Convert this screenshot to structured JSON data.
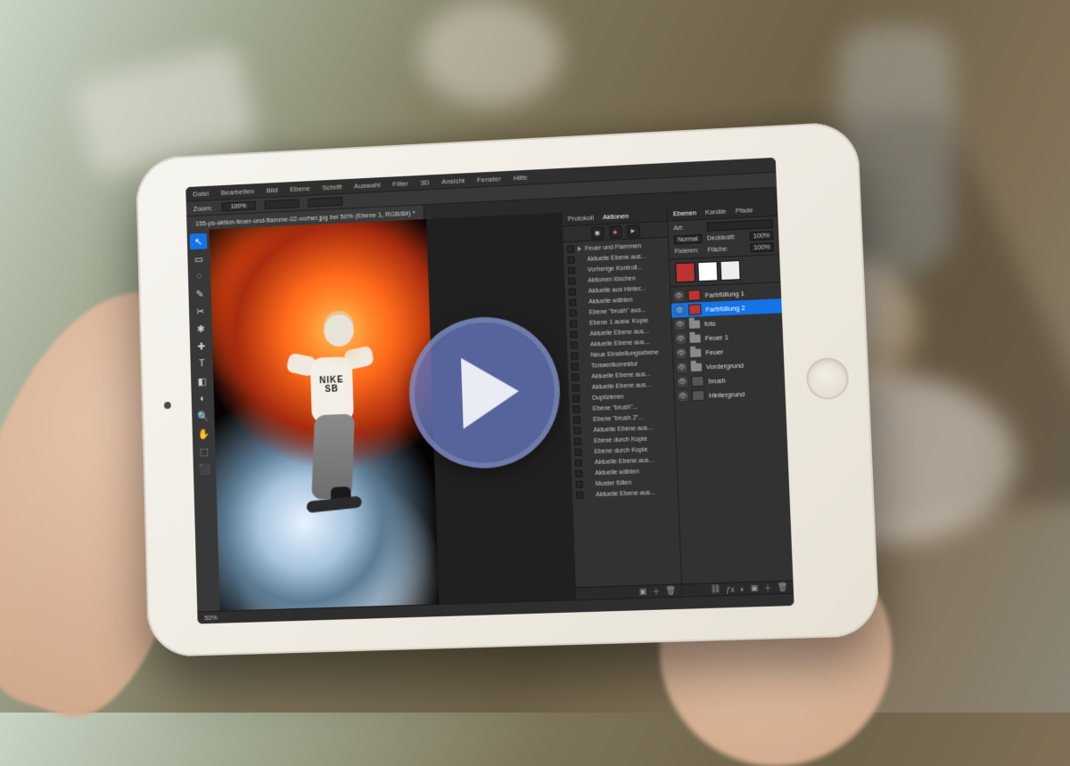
{
  "play_button_color": "#6071b2",
  "app": {
    "menubar": {
      "items": [
        "Datei",
        "Bearbeiten",
        "Bild",
        "Ebene",
        "Schrift",
        "Auswahl",
        "Filter",
        "3D",
        "Ansicht",
        "Fenster",
        "Hilfe"
      ]
    },
    "options_bar": {
      "zoom_label": "Zoom:",
      "zoom_value": "100%"
    },
    "document_tab": "155-ps-aktion-feuer-und-flamme-02-vorher.jpg bei 50% (Ebene 1, RGB/8#) *",
    "canvas": {
      "hoodie_text": "NIKE SB"
    },
    "status_bar": {
      "zoom": "50%"
    },
    "panels": {
      "actions": {
        "tabs": {
          "protocol": "Protokoll",
          "actions": "Aktionen"
        },
        "set_name": "Feuer und Flammen",
        "items": [
          "Aktuelle Ebene aus...",
          "Vorherige Kontroll...",
          "Aktionen löschen",
          "Aktuelle aus Hinter...",
          "Aktuelle wählen",
          "Ebene \"brush\" aus...",
          "Ebene 1 ausw. Kopie",
          "Aktuelle Ebene aus...",
          "Aktuelle Ebene aus...",
          "Neue Einstellungsebene",
          "Tonwertkorrektur",
          "Aktuelle Ebene aus...",
          "Aktuelle Ebene aus...",
          "Duplizieren",
          "Ebene \"brush\"...",
          "Ebene \"brush 2\"...",
          "Aktuelle Ebene aus...",
          "Ebene durch Kopie",
          "Ebene durch Kopie",
          "Aktuelle Ebene aus...",
          "Aktuelle wählen",
          "Muster füllen",
          "Aktuelle Ebene aus..."
        ]
      },
      "layers": {
        "tabs": {
          "layers": "Ebenen",
          "channels": "Kanäle",
          "paths": "Pfade"
        },
        "filter_label": "Art:",
        "blend_label": "Normal",
        "opacity_label": "Deckkraft:",
        "opacity_value": "100%",
        "lock_label": "Fixieren:",
        "fill_label": "Fläche:",
        "fill_value": "100%",
        "layers": [
          {
            "name": "Farbfüllung 1",
            "type": "adjust"
          },
          {
            "name": "Farbfüllung 2",
            "type": "adjust",
            "selected": true
          },
          {
            "name": "foto",
            "type": "folder"
          },
          {
            "name": "Feuer 1",
            "type": "folder"
          },
          {
            "name": "Feuer",
            "type": "folder"
          },
          {
            "name": "Vordergrund",
            "type": "folder"
          },
          {
            "name": "brush",
            "type": "layer"
          },
          {
            "name": "Hintergrund",
            "type": "layer"
          }
        ]
      }
    }
  }
}
